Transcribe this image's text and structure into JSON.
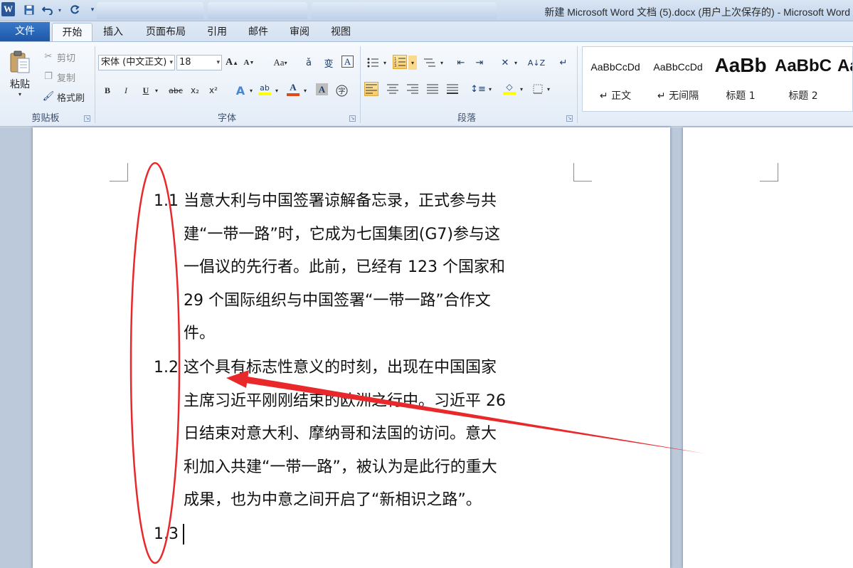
{
  "titlebar": {
    "title": "新建 Microsoft Word 文档 (5).docx (用户上次保存的) - Microsoft Word",
    "logo": "W"
  },
  "tabs": {
    "file": "文件",
    "items": [
      "开始",
      "插入",
      "页面布局",
      "引用",
      "邮件",
      "审阅",
      "视图"
    ],
    "active": "开始"
  },
  "clipboard": {
    "paste": "粘贴",
    "cut": "剪切",
    "copy": "复制",
    "format_painter": "格式刷",
    "group": "剪贴板"
  },
  "font": {
    "name": "宋体 (中文正文)",
    "size": "18",
    "grow": "A",
    "shrink": "A",
    "case": "Aa",
    "bold": "B",
    "italic": "I",
    "underline": "U",
    "strike": "abc",
    "sub": "x₂",
    "sup": "x²",
    "group": "字体"
  },
  "paragraph": {
    "group": "段落"
  },
  "styles": {
    "items": [
      {
        "sample": "AaBbCcDd",
        "name": "↵ 正文"
      },
      {
        "sample": "AaBbCcDd",
        "name": "↵ 无间隔"
      },
      {
        "sample": "AaBb",
        "name": "标题 1"
      },
      {
        "sample": "AaBbC",
        "name": "标题 2"
      },
      {
        "sample": "Aa",
        "name": ""
      }
    ]
  },
  "document": {
    "paragraphs": [
      {
        "number": "1.1",
        "lines": [
          "当意大利与中国签署谅解备忘录，正式参与共",
          "建“一带一路”时，它成为七国集团(G7)参与这",
          "一倡议的先行者。此前，已经有 123 个国家和",
          "29 个国际组织与中国签署“一带一路”合作文",
          "件。"
        ]
      },
      {
        "number": "1.2",
        "lines": [
          "这个具有标志性意义的时刻，出现在中国国家",
          "主席习近平刚刚结束的欧洲之行中。习近平 26",
          "日结束对意大利、摩纳哥和法国的访问。意大",
          "利加入共建“一带一路”，被认为是此行的重大",
          "成果，也为中意之间开启了“新相识之路”。"
        ]
      },
      {
        "number": "1.3",
        "lines": []
      }
    ]
  },
  "colors": {
    "annotation": "#e8282b",
    "file_tab": "#2b63b3"
  }
}
